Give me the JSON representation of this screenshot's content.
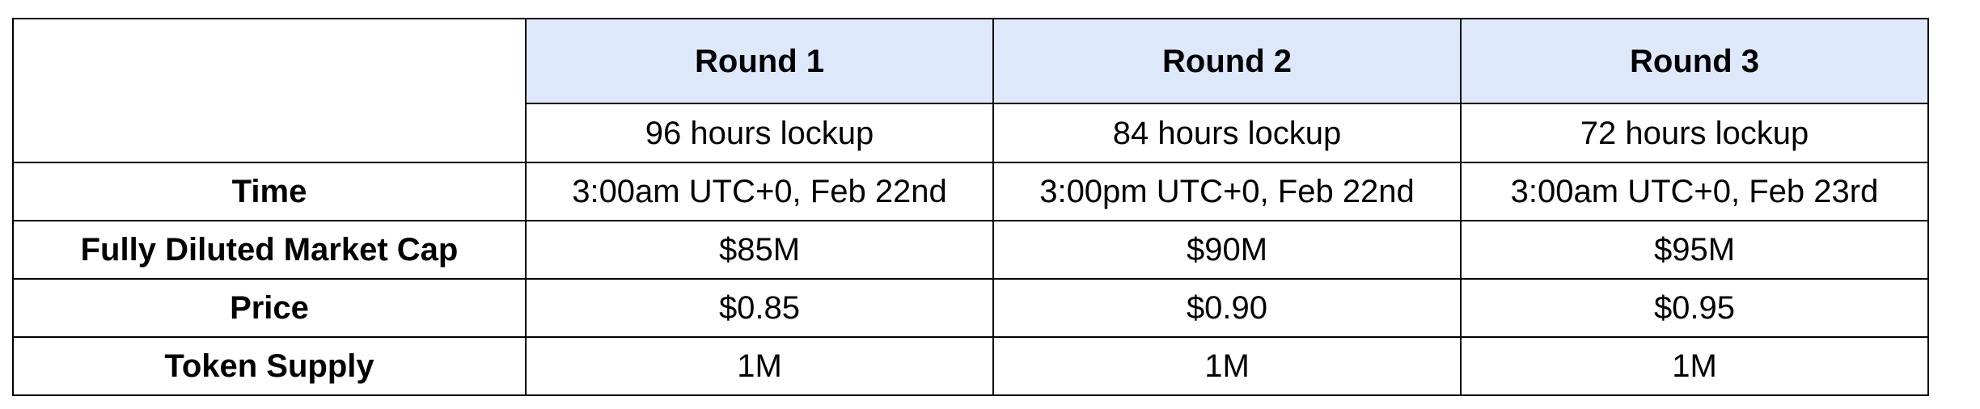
{
  "table": {
    "rounds": [
      {
        "title": "Round 1",
        "lockup": "96 hours lockup",
        "time": "3:00am UTC+0, Feb 22nd",
        "market_cap": "$85M",
        "price": "$0.85",
        "supply": "1M"
      },
      {
        "title": "Round 2",
        "lockup": "84 hours lockup",
        "time": "3:00pm UTC+0, Feb 22nd",
        "market_cap": "$90M",
        "price": "$0.90",
        "supply": "1M"
      },
      {
        "title": "Round 3",
        "lockup": "72 hours lockup",
        "time": "3:00am UTC+0, Feb 23rd",
        "market_cap": "$95M",
        "price": "$0.95",
        "supply": "1M"
      }
    ],
    "row_labels": {
      "time": "Time",
      "market_cap": "Fully Diluted Market Cap",
      "price": "Price",
      "supply": "Token Supply"
    },
    "colors": {
      "header_fill": "#dde9fb",
      "border": "#000000"
    }
  }
}
